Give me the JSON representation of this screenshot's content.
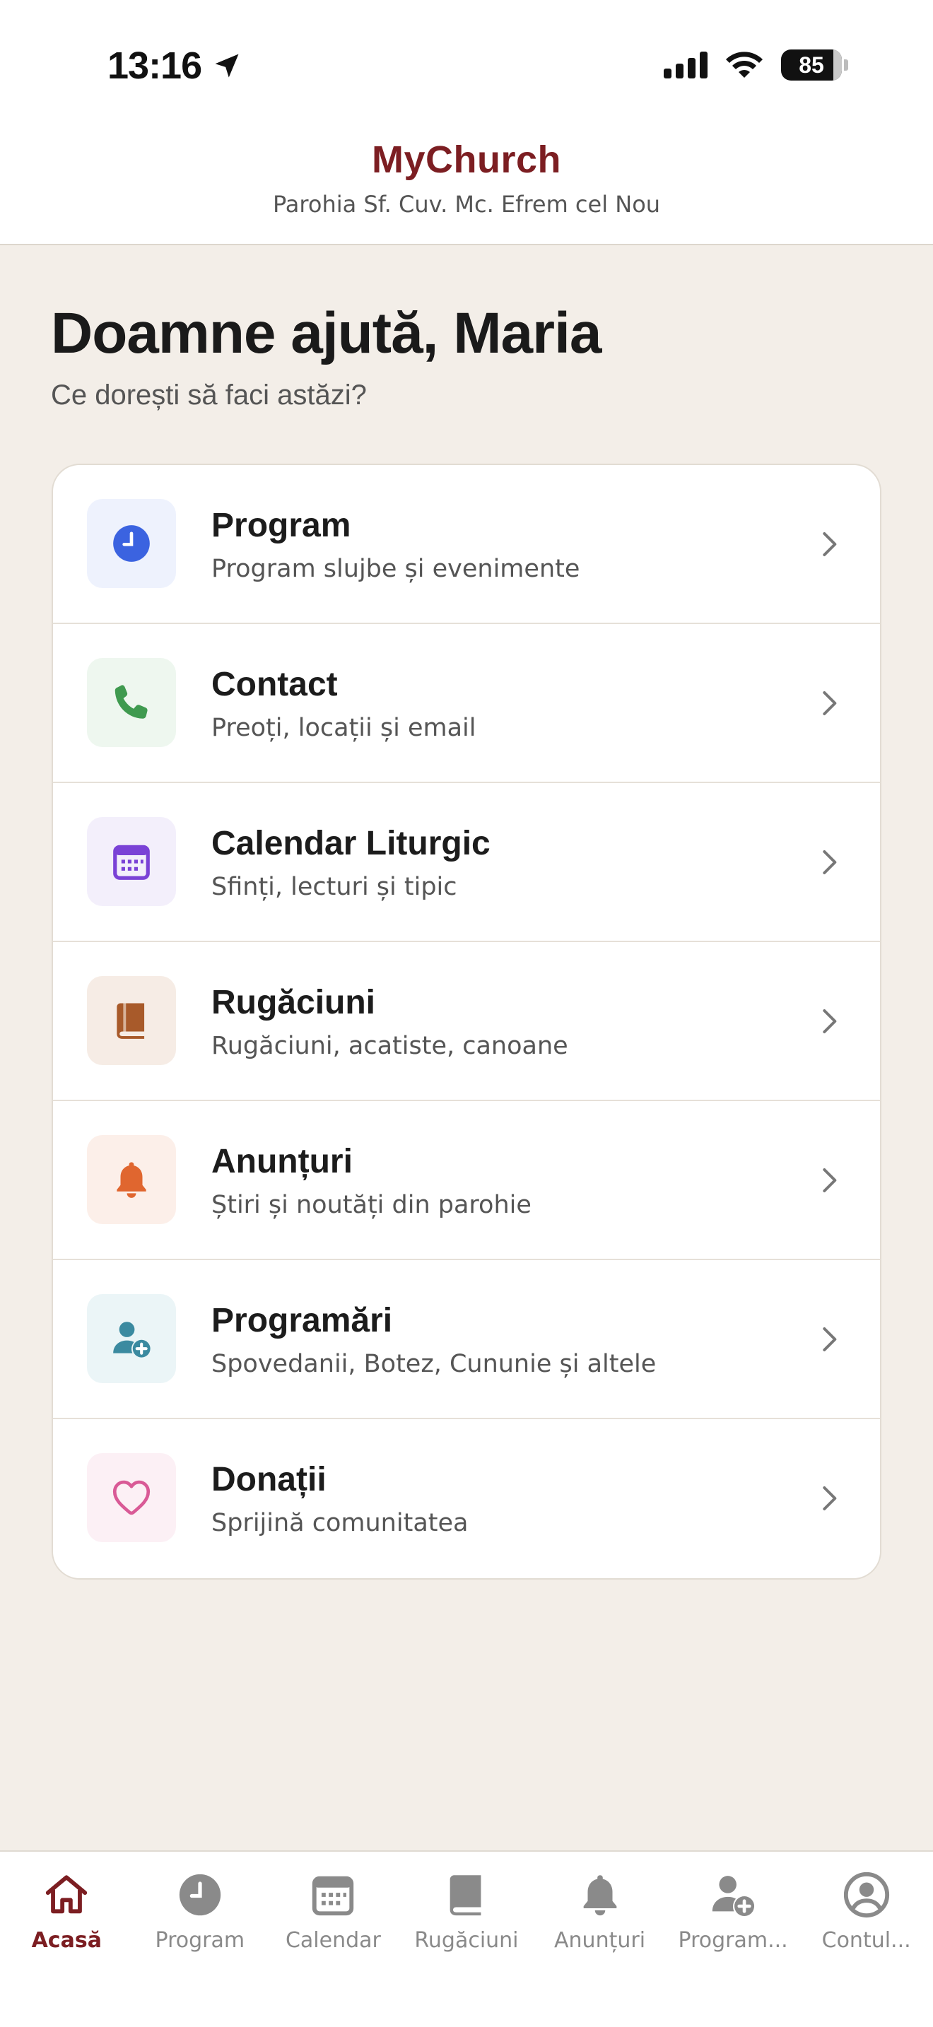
{
  "status_bar": {
    "time": "13:16",
    "battery": "85"
  },
  "header": {
    "title": "MyChurch",
    "subtitle": "Parohia Sf. Cuv. Mc. Efrem cel Nou"
  },
  "greeting": {
    "title": "Doamne ajută, Maria",
    "subtitle": "Ce dorești să faci astăzi?"
  },
  "menu": {
    "items": [
      {
        "title": "Program",
        "desc": "Program slujbe și evenimente",
        "icon": "clock-icon",
        "color": "#3b63e0",
        "bg": "#eef2fd"
      },
      {
        "title": "Contact",
        "desc": "Preoți, locații și email",
        "icon": "phone-icon",
        "color": "#3f9a4f",
        "bg": "#eef7ef"
      },
      {
        "title": "Calendar Liturgic",
        "desc": "Sfinți, lecturi și tipic",
        "icon": "calendar-icon",
        "color": "#7a42d6",
        "bg": "#f3effb"
      },
      {
        "title": "Rugăciuni",
        "desc": "Rugăciuni, acatiste, canoane",
        "icon": "book-icon",
        "color": "#a85a2a",
        "bg": "#f6ece5"
      },
      {
        "title": "Anunțuri",
        "desc": "Știri și noutăți din parohie",
        "icon": "bell-icon",
        "color": "#e0662f",
        "bg": "#fcefe9"
      },
      {
        "title": "Programări",
        "desc": "Spovedanii, Botez, Cununie și altele",
        "icon": "person-add-icon",
        "color": "#3b8aa0",
        "bg": "#ebf5f7"
      },
      {
        "title": "Donații",
        "desc": "Sprijină comunitatea",
        "icon": "heart-icon",
        "color": "#d95a96",
        "bg": "#fcf0f5"
      }
    ]
  },
  "tabbar": {
    "tabs": [
      {
        "label": "Acasă",
        "icon": "home-icon",
        "active": true
      },
      {
        "label": "Program",
        "icon": "clock-icon",
        "active": false
      },
      {
        "label": "Calendar",
        "icon": "calendar-icon",
        "active": false
      },
      {
        "label": "Rugăciuni",
        "icon": "book-icon",
        "active": false
      },
      {
        "label": "Anunțuri",
        "icon": "bell-icon",
        "active": false
      },
      {
        "label": "Program...",
        "icon": "person-add-icon",
        "active": false
      },
      {
        "label": "Contul...",
        "icon": "account-icon",
        "active": false
      }
    ]
  },
  "colors": {
    "brand": "#7c1e22",
    "background": "#f3eee8",
    "inactive": "#8a8a8a"
  }
}
